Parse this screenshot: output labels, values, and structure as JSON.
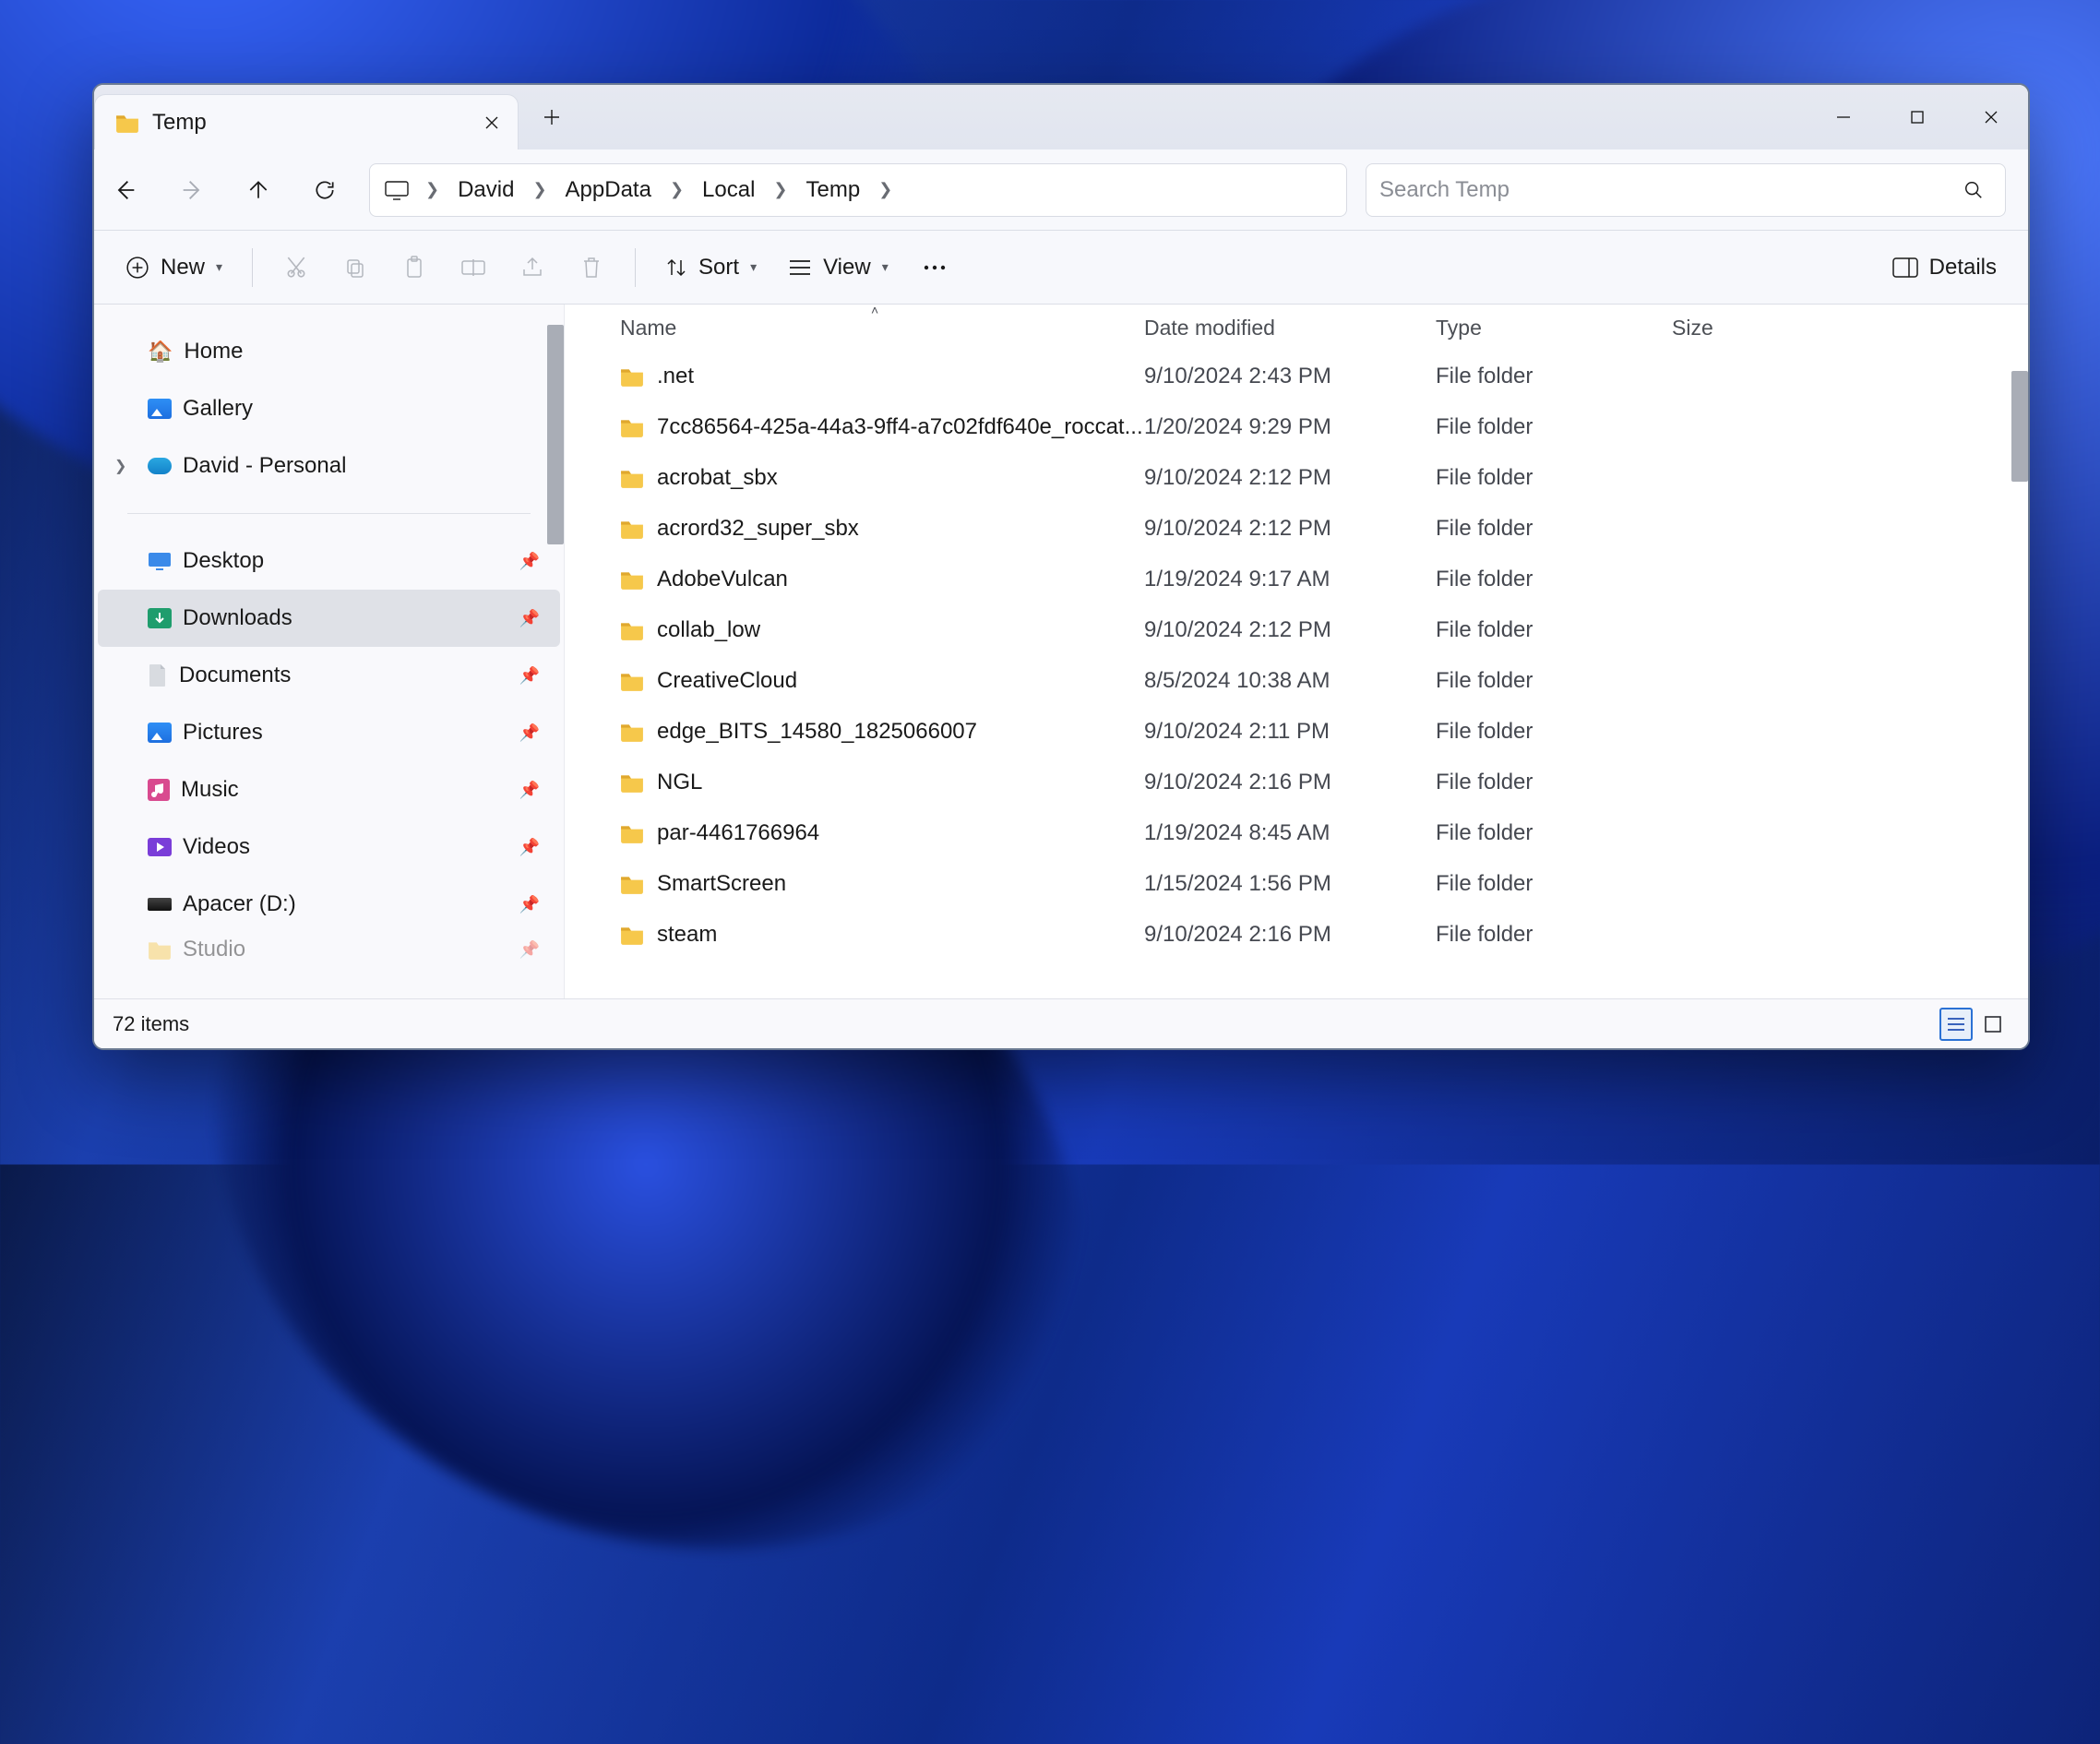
{
  "tab": {
    "title": "Temp"
  },
  "breadcrumb": [
    "David",
    "AppData",
    "Local",
    "Temp"
  ],
  "search": {
    "placeholder": "Search Temp"
  },
  "cmd": {
    "new": "New",
    "sort": "Sort",
    "view": "View",
    "details": "Details"
  },
  "columns": {
    "name": "Name",
    "date": "Date modified",
    "type": "Type",
    "size": "Size"
  },
  "nav": {
    "quick": [
      {
        "label": "Home",
        "icon": "home"
      },
      {
        "label": "Gallery",
        "icon": "gallery"
      },
      {
        "label": "David - Personal",
        "icon": "onedrive",
        "expandable": true
      }
    ],
    "pinned": [
      {
        "label": "Desktop",
        "icon": "desktop"
      },
      {
        "label": "Downloads",
        "icon": "downloads",
        "selected": true
      },
      {
        "label": "Documents",
        "icon": "documents"
      },
      {
        "label": "Pictures",
        "icon": "pictures"
      },
      {
        "label": "Music",
        "icon": "music"
      },
      {
        "label": "Videos",
        "icon": "videos"
      },
      {
        "label": "Apacer (D:)",
        "icon": "drive"
      },
      {
        "label": "Studio",
        "icon": "folder"
      }
    ]
  },
  "files": [
    {
      "name": ".net",
      "date": "9/10/2024 2:43 PM",
      "type": "File folder"
    },
    {
      "name": "7cc86564-425a-44a3-9ff4-a7c02fdf640e_roccat...",
      "date": "1/20/2024 9:29 PM",
      "type": "File folder"
    },
    {
      "name": "acrobat_sbx",
      "date": "9/10/2024 2:12 PM",
      "type": "File folder"
    },
    {
      "name": "acrord32_super_sbx",
      "date": "9/10/2024 2:12 PM",
      "type": "File folder"
    },
    {
      "name": "AdobeVulcan",
      "date": "1/19/2024 9:17 AM",
      "type": "File folder"
    },
    {
      "name": "collab_low",
      "date": "9/10/2024 2:12 PM",
      "type": "File folder"
    },
    {
      "name": "CreativeCloud",
      "date": "8/5/2024 10:38 AM",
      "type": "File folder"
    },
    {
      "name": "edge_BITS_14580_1825066007",
      "date": "9/10/2024 2:11 PM",
      "type": "File folder"
    },
    {
      "name": "NGL",
      "date": "9/10/2024 2:16 PM",
      "type": "File folder"
    },
    {
      "name": "par-4461766964",
      "date": "1/19/2024 8:45 AM",
      "type": "File folder"
    },
    {
      "name": "SmartScreen",
      "date": "1/15/2024 1:56 PM",
      "type": "File folder"
    },
    {
      "name": "steam",
      "date": "9/10/2024 2:16 PM",
      "type": "File folder"
    }
  ],
  "status": {
    "count": "72 items"
  }
}
